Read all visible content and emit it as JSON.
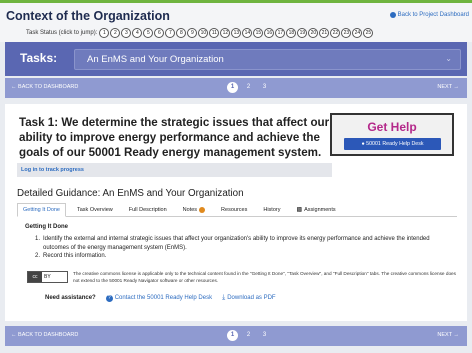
{
  "header": {
    "title": "Context of the Organization",
    "back_link": "Back to Project Dashboard",
    "status_label": "Task Status (click to jump):",
    "steps": [
      "1",
      "2",
      "3",
      "4",
      "5",
      "6",
      "7",
      "8",
      "9",
      "10",
      "11",
      "12",
      "13",
      "14",
      "15",
      "16",
      "17",
      "18",
      "19",
      "20",
      "21",
      "22",
      "23",
      "24",
      "25"
    ]
  },
  "tasks_bar": {
    "label": "Tasks:",
    "selected": "An EnMS and Your Organization"
  },
  "nav": {
    "back": "← BACK TO DASHBOARD",
    "next": "NEXT →",
    "pages": [
      "1",
      "2",
      "3"
    ],
    "active_page": "1"
  },
  "task": {
    "title": "Task 1: We determine the strategic issues that affect our ability to improve energy performance and achieve the goals of our 50001 Ready energy management system.",
    "track_link": "Log in to track progress"
  },
  "help": {
    "title": "Get Help",
    "button": "50001 Ready Help Desk"
  },
  "guidance": {
    "title": "Detailed Guidance: An EnMS and Your Organization",
    "tabs": [
      "Getting It Done",
      "Task Overview",
      "Full Description",
      "Notes",
      "Resources",
      "History",
      "Assignments"
    ],
    "section_heading": "Getting It Done",
    "steps": [
      "Identify the external and internal strategic issues that affect your organization's ability to improve its energy performance and achieve the intended outcomes of the energy management system (EnMS).",
      "Record this information."
    ]
  },
  "license": {
    "badge_left": "cc",
    "badge_right": "BY",
    "text": "The creative commons license is applicable only to the technical content found in the \"Getting It Done\", \"Task Overview\", and \"Full Description\" tabs. The creative commons license does not extend to the 50001 Ready Navigator software or other resources."
  },
  "assistance": {
    "label": "Need assistance?",
    "contact": "Contact the 50001 Ready Help Desk",
    "download": "Download as PDF"
  },
  "colors": {
    "accent": "#5a67b2",
    "nav_bar": "#8f9ad1",
    "help_title": "#b4288a",
    "link": "#2d6cc0",
    "top_line": "#6fb43f"
  }
}
